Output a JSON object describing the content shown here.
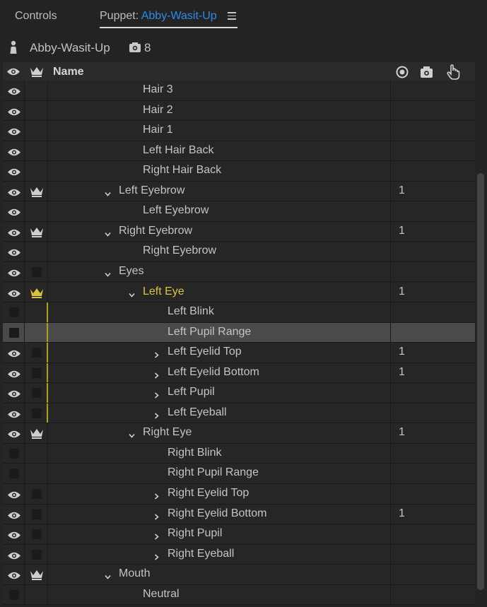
{
  "tabs": {
    "controls": "Controls",
    "puppet_prefix": "Puppet:",
    "puppet_name": "Abby-Wasit-Up"
  },
  "puppet": {
    "name": "Abby-Wasit-Up",
    "camera_count": "8"
  },
  "header": {
    "name": "Name"
  },
  "colors": {
    "accent": "#2d8ceb",
    "selected_yellow": "#d9c53a",
    "row_bg": "#262626",
    "selected_row": "#4a4a4a"
  },
  "rows": [
    {
      "label": "Hair 3",
      "indent": 3,
      "eye": true,
      "crown": "none",
      "chevron": "none",
      "value": ""
    },
    {
      "label": "Hair 2",
      "indent": 3,
      "eye": true,
      "crown": "none",
      "chevron": "none",
      "value": ""
    },
    {
      "label": "Hair 1",
      "indent": 3,
      "eye": true,
      "crown": "none",
      "chevron": "none",
      "value": ""
    },
    {
      "label": "Left Hair Back",
      "indent": 3,
      "eye": true,
      "crown": "none",
      "chevron": "none",
      "value": ""
    },
    {
      "label": "Right Hair Back",
      "indent": 3,
      "eye": true,
      "crown": "none",
      "chevron": "none",
      "value": ""
    },
    {
      "label": "Left Eyebrow",
      "indent": 2,
      "eye": true,
      "crown": "crown",
      "chevron": "down",
      "value": "1"
    },
    {
      "label": "Left Eyebrow",
      "indent": 3,
      "eye": true,
      "crown": "none",
      "chevron": "none",
      "value": ""
    },
    {
      "label": "Right Eyebrow",
      "indent": 2,
      "eye": true,
      "crown": "crown",
      "chevron": "down",
      "value": "1"
    },
    {
      "label": "Right Eyebrow",
      "indent": 3,
      "eye": true,
      "crown": "none",
      "chevron": "none",
      "value": ""
    },
    {
      "label": "Eyes",
      "indent": 2,
      "eye": true,
      "crown": "square",
      "chevron": "down",
      "value": ""
    },
    {
      "label": "Left Eye",
      "indent": 3,
      "eye": true,
      "crown": "crown-yellow",
      "chevron": "down",
      "value": "1",
      "yellow": true
    },
    {
      "label": "Left Blink",
      "indent": 4,
      "eye": false,
      "crown": "none",
      "chevron": "none",
      "value": "",
      "yline": true
    },
    {
      "label": "Left Pupil Range",
      "indent": 4,
      "eye": false,
      "crown": "none",
      "chevron": "none",
      "value": "",
      "yline": true,
      "selected": true
    },
    {
      "label": "Left Eyelid Top",
      "indent": 4,
      "eye": true,
      "crown": "square",
      "chevron": "right",
      "value": "1",
      "yline": true
    },
    {
      "label": "Left Eyelid Bottom",
      "indent": 4,
      "eye": true,
      "crown": "square",
      "chevron": "right",
      "value": "1",
      "yline": true
    },
    {
      "label": "Left Pupil",
      "indent": 4,
      "eye": true,
      "crown": "square",
      "chevron": "right",
      "value": "",
      "yline": true
    },
    {
      "label": "Left Eyeball",
      "indent": 4,
      "eye": true,
      "crown": "square",
      "chevron": "right",
      "value": "",
      "yline": true
    },
    {
      "label": "Right Eye",
      "indent": 3,
      "eye": true,
      "crown": "crown",
      "chevron": "down",
      "value": "1"
    },
    {
      "label": "Right Blink",
      "indent": 4,
      "eye": false,
      "crown": "none",
      "chevron": "none",
      "value": ""
    },
    {
      "label": "Right Pupil Range",
      "indent": 4,
      "eye": false,
      "crown": "none",
      "chevron": "none",
      "value": ""
    },
    {
      "label": "Right Eyelid Top",
      "indent": 4,
      "eye": true,
      "crown": "square",
      "chevron": "right",
      "value": ""
    },
    {
      "label": "Right Eyelid Bottom",
      "indent": 4,
      "eye": true,
      "crown": "square",
      "chevron": "right",
      "value": "1"
    },
    {
      "label": "Right Pupil",
      "indent": 4,
      "eye": true,
      "crown": "square",
      "chevron": "right",
      "value": ""
    },
    {
      "label": "Right Eyeball",
      "indent": 4,
      "eye": true,
      "crown": "square",
      "chevron": "right",
      "value": ""
    },
    {
      "label": "Mouth",
      "indent": 2,
      "eye": true,
      "crown": "crown",
      "chevron": "down",
      "value": ""
    },
    {
      "label": "Neutral",
      "indent": 3,
      "eye": false,
      "crown": "none",
      "chevron": "none",
      "value": ""
    }
  ]
}
